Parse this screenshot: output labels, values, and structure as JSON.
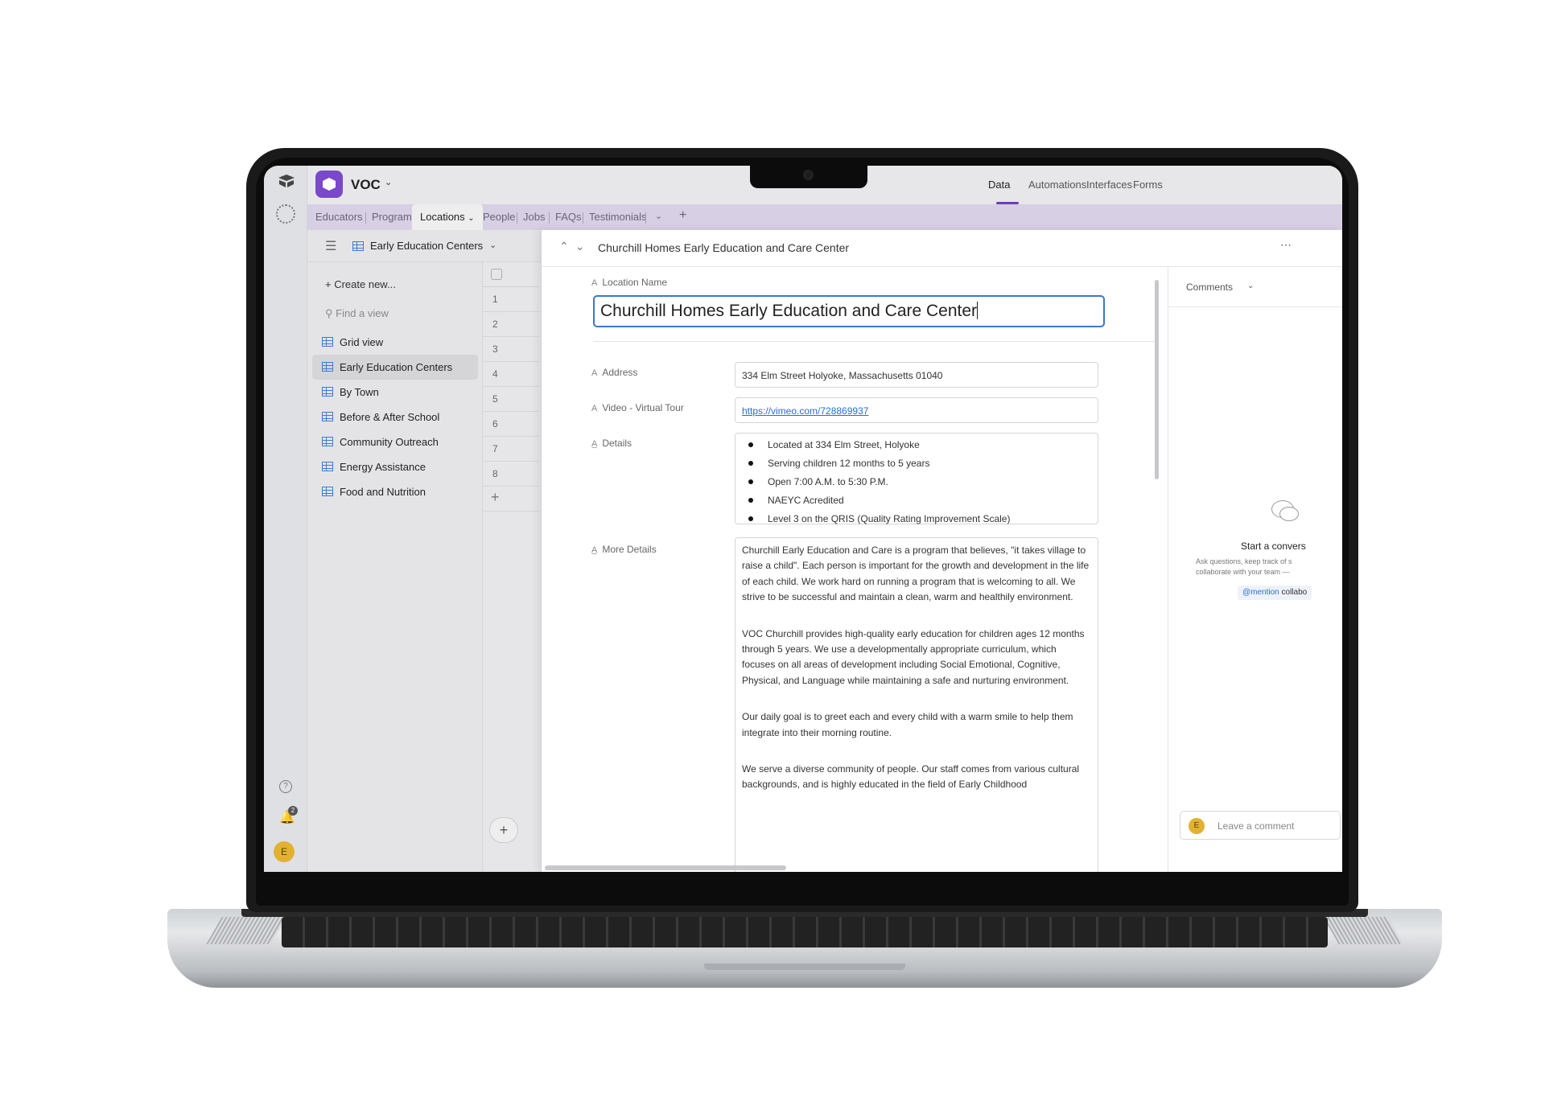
{
  "app": {
    "base_name": "VOC",
    "top_nav": [
      "Data",
      "Automations",
      "Interfaces",
      "Forms"
    ],
    "active_top_nav": "Data",
    "notification_count": "2",
    "user_initial": "E"
  },
  "tabs": [
    "Educators",
    "Programs",
    "Locations",
    "People",
    "Jobs",
    "FAQs",
    "Testimonials"
  ],
  "active_tab": "Locations",
  "view_bar": {
    "current_view": "Early Education Centers"
  },
  "sidebar": {
    "create_label": "Create new...",
    "find_placeholder": "Find a view",
    "views": [
      "Grid view",
      "Early Education Centers",
      "By Town",
      "Before & After School",
      "Community Outreach",
      "Energy Assistance",
      "Food and Nutrition"
    ],
    "active_view": "Early Education Centers"
  },
  "grid_rows": [
    "1",
    "2",
    "3",
    "4",
    "5",
    "6",
    "7",
    "8"
  ],
  "record": {
    "title": "Churchill Homes Early Education and Care Center",
    "fields": {
      "location_name_label": "Location Name",
      "location_name_value": "Churchill Homes Early Education and Care Center",
      "address_label": "Address",
      "address_value": "334 Elm Street Holyoke, Massachusetts 01040",
      "video_label": "Video - Virtual Tour",
      "video_value": "https://vimeo.com/728869937",
      "details_label": "Details",
      "details_items": [
        "Located at 334 Elm Street, Holyoke",
        "Serving children 12 months to 5 years",
        "Open 7:00 A.M. to 5:30 P.M.",
        "NAEYC Acredited",
        "Level 3 on the QRIS (Quality Rating Improvement Scale)"
      ],
      "more_details_label": "More Details",
      "more_details_paragraphs": [
        "Churchill Early Education and Care is a program that believes, \"it takes village to raise a child\". Each person is important for the growth and development in the life of each child. We work hard on running a program that is welcoming to all. We strive to be successful and maintain a clean, warm and healthily environment.",
        "VOC Churchill provides high-quality early education for children ages 12 months through 5 years. We use a developmentally appropriate curriculum, which focuses on all areas of development including Social Emotional, Cognitive, Physical, and Language while maintaining a safe and nurturing environment.",
        "Our daily goal is to greet each and every child with a warm smile to help them integrate into their morning routine.",
        "We serve a diverse community of people. Our staff comes from various cultural backgrounds, and is highly educated in the field of Early Childhood"
      ]
    }
  },
  "comments": {
    "header": "Comments",
    "start_title": "Start a convers",
    "start_body": "Ask questions, keep track of s\ncollaborate with your team —",
    "mention_label": "@mention",
    "mention_rest": " collabo",
    "input_placeholder": "Leave a comment",
    "avatar_initial": "E"
  },
  "colors": {
    "accent_purple": "#7a49c9",
    "link_blue": "#2a6cd6",
    "tab_bar": "#d7cfe3",
    "avatar_yellow": "#e3b131"
  },
  "icons": [
    "base-logo-icon",
    "workspace-ring-icon",
    "help-icon",
    "bell-icon",
    "hamburger-icon",
    "grid-view-icon",
    "search-icon",
    "plus-icon",
    "chevron-up-icon",
    "chevron-down-icon",
    "more-icon",
    "comment-bubble-icon",
    "text-field-icon",
    "long-text-icon"
  ]
}
